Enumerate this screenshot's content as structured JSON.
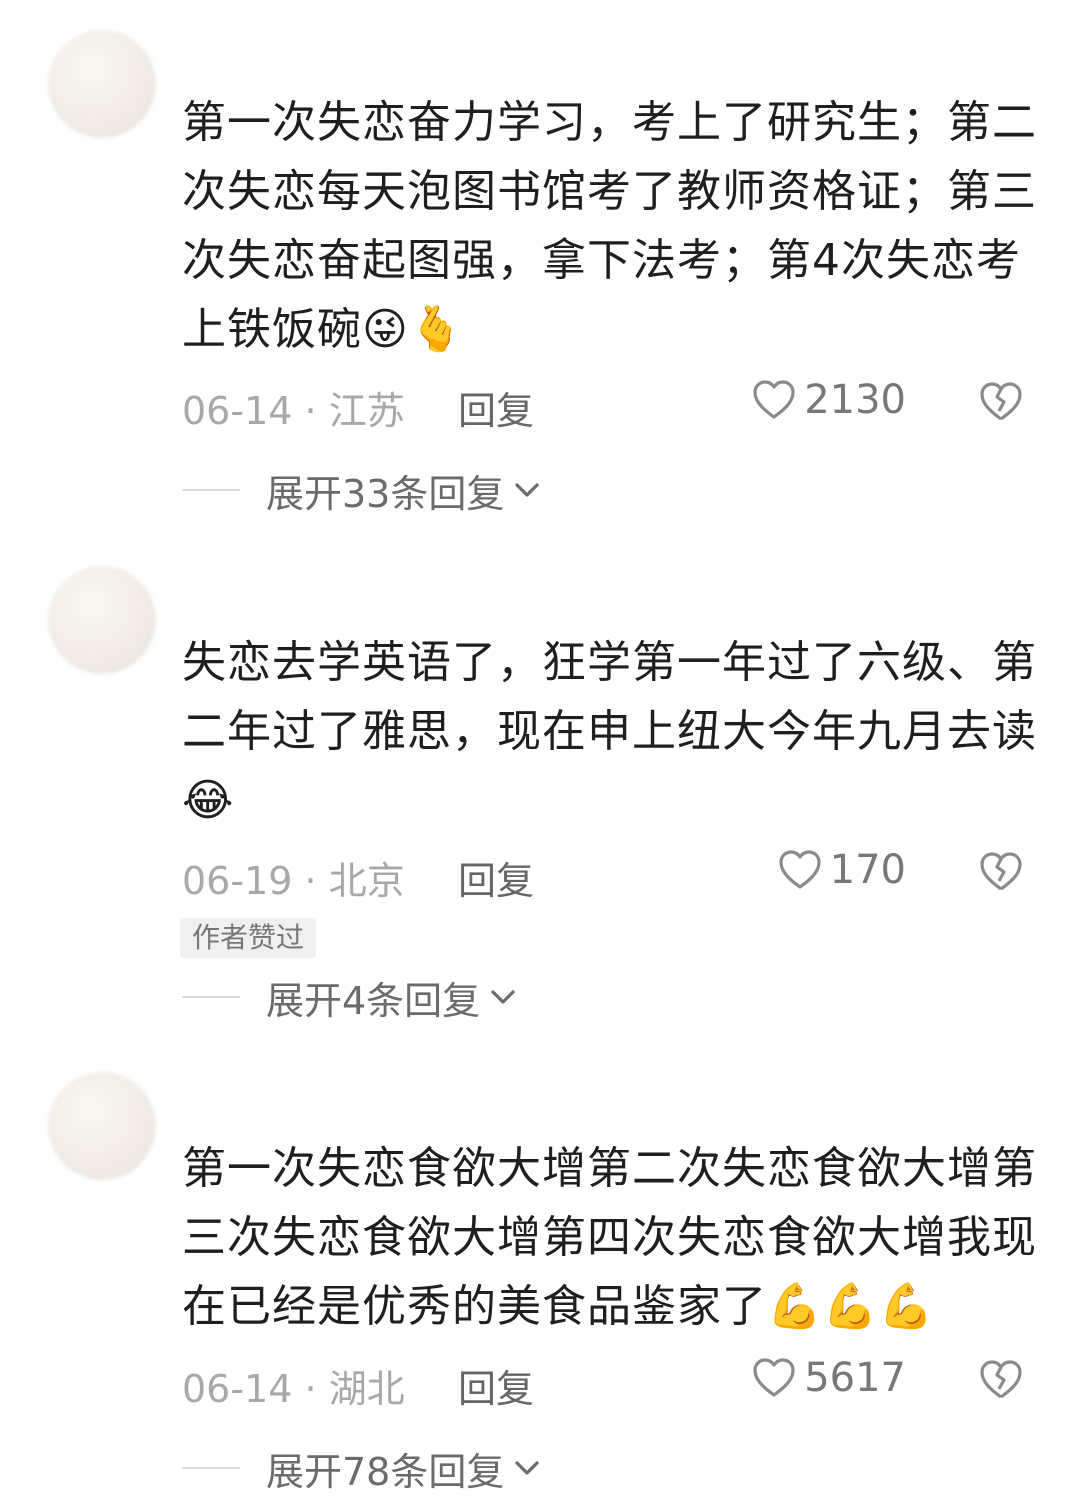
{
  "comments": [
    {
      "text": "第一次失恋奋力学习，考上了研究生；第二次失恋每天泡图书馆考了教师资格证；第三次失恋奋起图强，拿下法考；第4次失恋考上铁饭碗",
      "emoji": "😜🫰",
      "date": "06-14",
      "location": "江苏",
      "reply": "回复",
      "likes": "2130",
      "expand": "展开33条回复"
    },
    {
      "text": "失恋去学英语了，狂学第一年过了六级、第二年过了雅思，现在申上纽大今年九月去读",
      "emoji": "😂",
      "date": "06-19",
      "location": "北京",
      "reply": "回复",
      "likes": "170",
      "badge": "作者赞过",
      "expand": "展开4条回复"
    },
    {
      "text": "第一次失恋食欲大增第二次失恋食欲大增第三次失恋食欲大增第四次失恋食欲大增我现在已经是优秀的美食品鉴家了",
      "emoji": "💪💪💪",
      "date": "06-14",
      "location": "湖北",
      "reply": "回复",
      "likes": "5617",
      "expand": "展开78条回复"
    }
  ],
  "separator": "·"
}
